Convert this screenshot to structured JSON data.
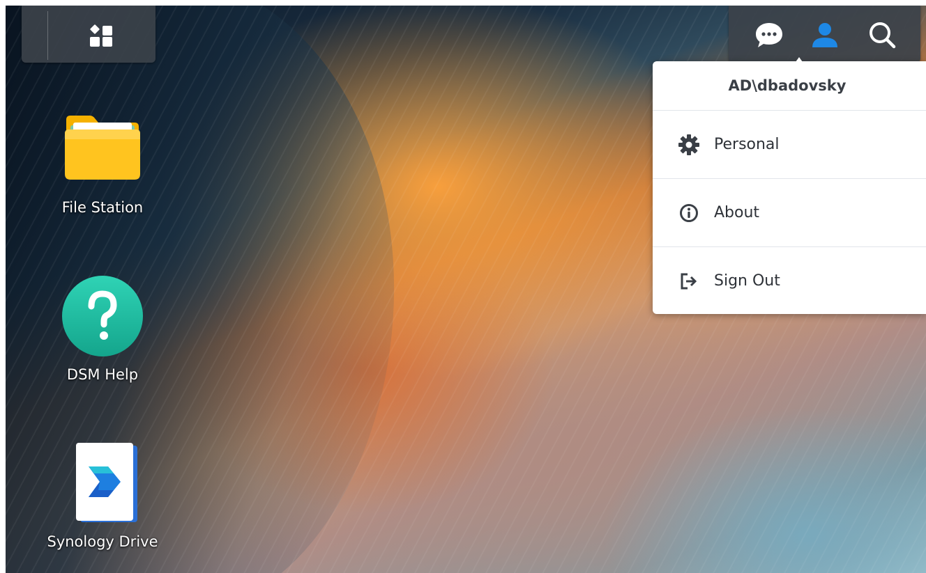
{
  "taskbar": {
    "main_menu_icon": "grid-apps-icon"
  },
  "tray": {
    "chat_icon": "chat-bubble-icon",
    "user_icon": "user-icon",
    "search_icon": "search-icon",
    "active_color": "#1e88e5"
  },
  "user_menu": {
    "username": "AD\\dbadovsky",
    "items": [
      {
        "label": "Personal",
        "icon": "gear-icon"
      },
      {
        "label": "About",
        "icon": "info-icon"
      },
      {
        "label": "Sign Out",
        "icon": "sign-out-icon"
      }
    ]
  },
  "desktop": {
    "shortcuts": [
      {
        "label": "File Station",
        "icon": "folder-icon"
      },
      {
        "label": "DSM Help",
        "icon": "help-icon"
      },
      {
        "label": "Synology Drive",
        "icon": "synology-drive-icon"
      }
    ]
  }
}
